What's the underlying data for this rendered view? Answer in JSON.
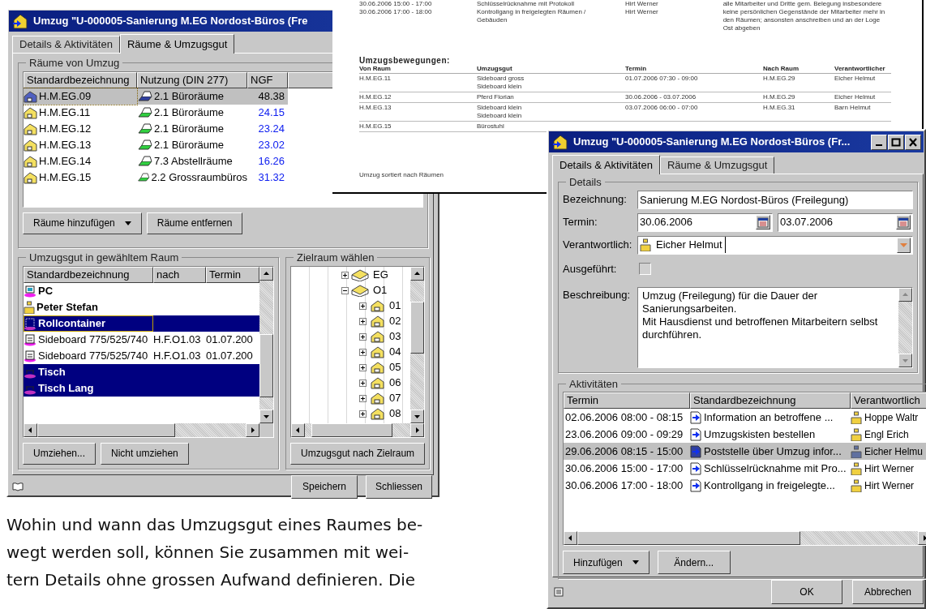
{
  "rooms_window": {
    "title": "Umzug \"U-000005-Sanierung M.EG Nordost-Büros (Fre",
    "tabs": [
      {
        "label": "Details & Aktivitäten",
        "selected": false
      },
      {
        "label": "Räume & Umzugsgut",
        "selected": true
      }
    ],
    "rooms_group": {
      "title": "Räume von Umzug",
      "columns": [
        "Standardbezeichnung",
        "Nutzung (DIN 277)",
        "NGF"
      ],
      "rows": [
        {
          "name": "H.M.EG.09",
          "usage": "2.1 Büroräume",
          "ngf": "48.38",
          "selected": true
        },
        {
          "name": "H.M.EG.11",
          "usage": "2.1 Büroräume",
          "ngf": "24.15",
          "selected": false
        },
        {
          "name": "H.M.EG.12",
          "usage": "2.1 Büroräume",
          "ngf": "23.24",
          "selected": false
        },
        {
          "name": "H.M.EG.13",
          "usage": "2.1 Büroräume",
          "ngf": "23.02",
          "selected": false
        },
        {
          "name": "H.M.EG.14",
          "usage": "7.3 Abstellräume",
          "ngf": "16.26",
          "selected": false
        },
        {
          "name": "H.M.EG.15",
          "usage": "2.2 Grossraumbüros",
          "ngf": "31.32",
          "selected": false
        }
      ],
      "buttons": [
        {
          "label": "Räume hinzufügen",
          "kind": "dropdown"
        },
        {
          "label": "Räume entfernen",
          "kind": "plain"
        }
      ]
    },
    "goods_group": {
      "title": "Umzugsgut in gewähltem Raum",
      "columns": [
        "Standardbezeichnung",
        "nach",
        "Termin"
      ],
      "rows": [
        {
          "kind": "computer",
          "name": "PC",
          "bold": true,
          "selected": false
        },
        {
          "kind": "person",
          "name": "Peter Stefan",
          "bold": true,
          "selected": false
        },
        {
          "kind": "container",
          "name": "Rollcontainer",
          "bold": true,
          "selected": true
        },
        {
          "kind": "sideboard",
          "name": "Sideboard 775/525/740",
          "to": "H.F.O1.03",
          "date": "01.07.200",
          "bold": false,
          "selected": false
        },
        {
          "kind": "sideboard",
          "name": "Sideboard 775/525/740",
          "to": "H.F.O1.03",
          "date": "01.07.200",
          "bold": false,
          "selected": false
        },
        {
          "kind": "table",
          "name": "Tisch",
          "bold": true,
          "selected": true
        },
        {
          "kind": "table",
          "name": "Tisch Lang",
          "bold": true,
          "selected": true
        }
      ],
      "buttons": [
        {
          "label": "Umziehen...",
          "kind": "plain"
        },
        {
          "label": "Nicht umziehen",
          "kind": "plain"
        }
      ]
    },
    "target_group": {
      "title": "Zielraum wählen",
      "tree": [
        {
          "label": "EG",
          "expanded": false
        },
        {
          "label": "O1",
          "expanded": true,
          "children": [
            {
              "label": "01",
              "expanded": false
            },
            {
              "label": "02",
              "expanded": false
            },
            {
              "label": "03",
              "expanded": false
            },
            {
              "label": "04",
              "expanded": false
            },
            {
              "label": "05",
              "expanded": false
            },
            {
              "label": "06",
              "expanded": false
            },
            {
              "label": "07",
              "expanded": false
            },
            {
              "label": "08",
              "expanded": false
            }
          ]
        }
      ],
      "button": "Umzugsgut nach Zielraum"
    },
    "buttons": [
      "Speichern",
      "Schliessen"
    ]
  },
  "report": {
    "activities": [
      {
        "date": "30.06.2006 15:00 - 17:00",
        "name": "Schlüsselrücknahme mit Protokoll",
        "person": "Hirt Werner"
      },
      {
        "date": "30.06.2006 17:00 - 18:00",
        "name": "Kontrollgang in freigelegten Räumen / Gebäuden",
        "person": "Hirt Werner"
      }
    ],
    "note": "alle Mitarbeiter und Dritte gem. Belegung insbesondere keine persönlichen Gegenstände der Mitarbeiter mehr in den Räumen; ansonsten anschreiben und an der Loge Ost abgeben",
    "moves_title": "Umzugsbewegungen:",
    "columns": [
      "Von Raum",
      "Umzugsgut",
      "Termin",
      "Nach Raum",
      "Verantwortlicher"
    ],
    "rows": [
      [
        "H.M.EG.11",
        "Sideboard gross\nSideboard klein",
        "01.07.2006 07:30 - 09:00",
        "H.M.EG.29",
        "Eicher Helmut"
      ],
      [
        "H.M.EG.12",
        "Pferd Florian",
        "30.06.2006 - 03.07.2006",
        "H.M.EG.29",
        "Eicher Helmut"
      ],
      [
        "H.M.EG.13",
        "Sideboard klein\nSideboard klein",
        "03.07.2006 06:00 - 07:00",
        "H.M.EG.31",
        "Barn Helmut"
      ],
      [
        "H.M.EG.15",
        "Bürostuhl"
      ]
    ],
    "footer": "Umzug sortiert nach Räumen"
  },
  "details_window": {
    "title": "Umzug \"U-000005-Sanierung M.EG Nordost-Büros (Fr...",
    "tabs": [
      {
        "label": "Details & Aktivitäten",
        "selected": true
      },
      {
        "label": "Räume & Umzugsgut",
        "selected": false
      }
    ],
    "details_group": {
      "title": "Details",
      "fields": [
        {
          "kind": "text",
          "label": "Bezeichnung:",
          "value": "Sanierung M.EG Nordost-Büros (Freilegung)"
        },
        {
          "kind": "dates",
          "label": "Termin:",
          "values": [
            "30.06.2006",
            "03.07.2006"
          ]
        },
        {
          "kind": "person",
          "label": "Verantwortlich:",
          "value": "Eicher Helmut"
        },
        {
          "kind": "checkbox",
          "label": "Ausgeführt:",
          "checked": false
        },
        {
          "kind": "textarea",
          "label": "Beschreibung:",
          "value": "Umzug (Freilegung) für die Dauer der\nSanierungsarbeiten.\nMit Hausdienst und betroffenen Mitarbeitern selbst\ndurchführen."
        }
      ]
    },
    "activities_group": {
      "title": "Aktivitäten",
      "columns": [
        "Termin",
        "Standardbezeichnung",
        "Verantwortlich"
      ],
      "rows": [
        {
          "date": "02.06.2006 08:00 - 08:15",
          "name": "Information an betroffene ...",
          "person": "Hoppe Waltr",
          "selected": false
        },
        {
          "date": "23.06.2006 09:00 - 09:29",
          "name": "Umzugskisten bestellen",
          "person": "Engl Erich",
          "selected": false
        },
        {
          "date": "29.06.2006 08:15 - 15:00",
          "name": "Poststelle über Umzug infor...",
          "person": "Eicher Helmu",
          "selected": true
        },
        {
          "date": "30.06.2006 15:00 - 17:00",
          "name": "Schlüsselrücknahme mit Pro...",
          "person": "Hirt Werner",
          "selected": false
        },
        {
          "date": "30.06.2006 17:00 - 18:00",
          "name": "Kontrollgang in freigelegte...",
          "person": "Hirt Werner",
          "selected": false
        }
      ],
      "buttons": [
        {
          "label": "Hinzufügen",
          "kind": "dropdown"
        },
        {
          "label": "Ändern...",
          "kind": "plain"
        }
      ]
    },
    "buttons": [
      "OK",
      "Abbrechen"
    ]
  },
  "paragraph": "Wohin und wann das Umzugsgut eines Raumes be-\nwegt werden soll, können Sie zusammen mit wei-\ntern Details ohne grossen Aufwand definieren. Die"
}
